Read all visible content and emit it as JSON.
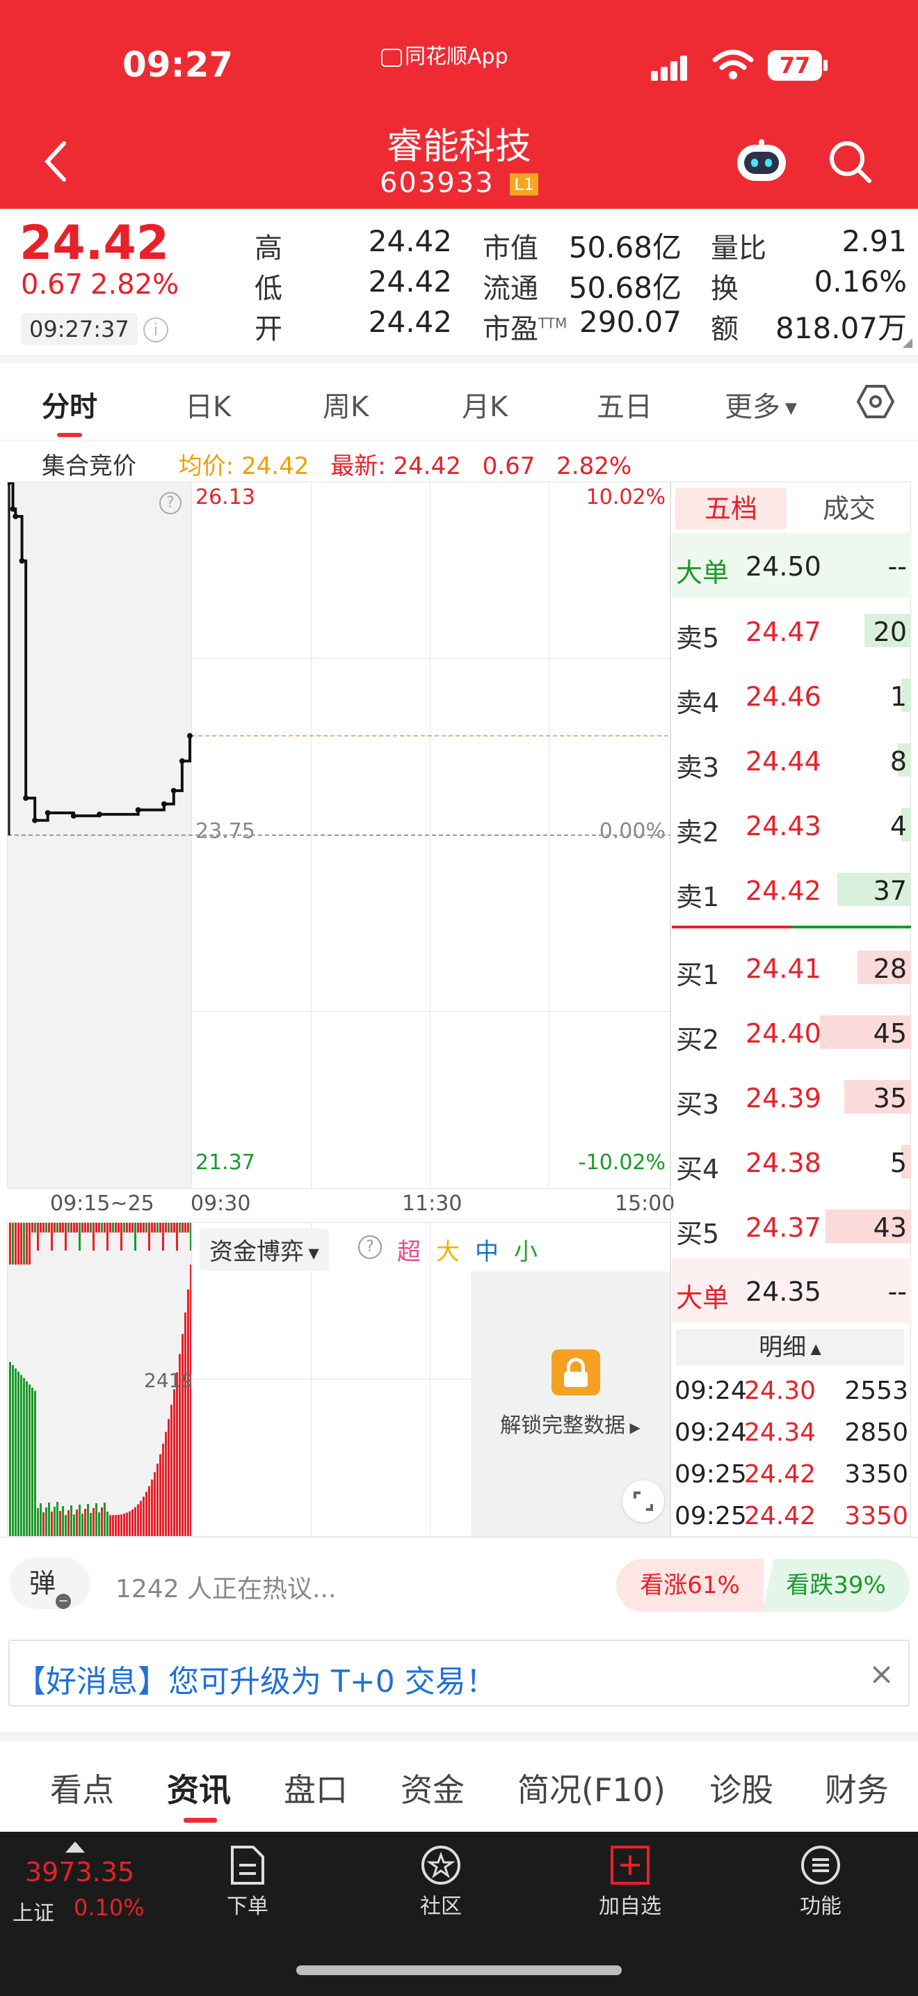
{
  "status_bar": {
    "time": "09:27",
    "app_label": "同花顺App",
    "battery": "77"
  },
  "header": {
    "title": "睿能科技",
    "code": "603933",
    "level_badge": "L1"
  },
  "quote": {
    "price": "24.42",
    "change": "0.67",
    "change_pct": "2.82%",
    "time": "09:27:37",
    "stats": [
      {
        "label": "高",
        "value": "24.42"
      },
      {
        "label": "低",
        "value": "24.42"
      },
      {
        "label": "开",
        "value": "24.42"
      },
      {
        "label": "市值",
        "value": "50.68亿"
      },
      {
        "label": "流通",
        "value": "50.68亿"
      },
      {
        "label": "市盈",
        "sup": "TTM",
        "value": "290.07"
      },
      {
        "label": "量比",
        "value": "2.91"
      },
      {
        "label": "换",
        "value": "0.16%"
      },
      {
        "label": "额",
        "value": "818.07万"
      }
    ]
  },
  "chart_tabs": [
    "分时",
    "日K",
    "周K",
    "月K",
    "五日",
    "更多"
  ],
  "auction_bar": {
    "label": "集合竞价",
    "avg": "均价: 24.42",
    "latest": "最新: 24.42",
    "change": "0.67",
    "change_pct": "2.82%"
  },
  "chart_data": {
    "type": "line",
    "title": "",
    "y_top": "26.13",
    "y_mid": "23.75",
    "y_bottom": "21.37",
    "pct_top": "10.02%",
    "pct_mid": "0.00%",
    "pct_bottom": "-10.02%",
    "ylim": [
      21.37,
      26.13
    ],
    "x_labels": [
      "09:15~25",
      "09:30",
      "11:30",
      "15:00"
    ],
    "auction_series": {
      "x": [
        0,
        6,
        10,
        20,
        26,
        40,
        60,
        100,
        140,
        200,
        240,
        255,
        268,
        280
      ],
      "y": [
        26.13,
        25.95,
        25.9,
        25.6,
        24.0,
        23.85,
        23.9,
        23.88,
        23.89,
        23.92,
        23.96,
        24.05,
        24.25,
        24.42
      ]
    },
    "ref_price": 23.75,
    "current_price": 24.42
  },
  "fund_panel": {
    "label": "资金博弈",
    "categories": [
      "超",
      "大",
      "中",
      "小"
    ],
    "side_value": "2419",
    "unlock": "解锁完整数据"
  },
  "order_book": {
    "tabs": [
      "五档",
      "成交"
    ],
    "big_sell": {
      "label": "大单",
      "price": "24.50",
      "vol": "--"
    },
    "asks": [
      {
        "label": "卖5",
        "price": "24.47",
        "vol": "20",
        "fill": 0.35
      },
      {
        "label": "卖4",
        "price": "24.46",
        "vol": "1",
        "fill": 0.02
      },
      {
        "label": "卖3",
        "price": "24.44",
        "vol": "8",
        "fill": 0.1
      },
      {
        "label": "卖2",
        "price": "24.43",
        "vol": "4",
        "fill": 0.05
      },
      {
        "label": "卖1",
        "price": "24.42",
        "vol": "37",
        "fill": 0.55
      }
    ],
    "bids": [
      {
        "label": "买1",
        "price": "24.41",
        "vol": "28",
        "fill": 0.4
      },
      {
        "label": "买2",
        "price": "24.40",
        "vol": "45",
        "fill": 0.68
      },
      {
        "label": "买3",
        "price": "24.39",
        "vol": "35",
        "fill": 0.5
      },
      {
        "label": "买4",
        "price": "24.38",
        "vol": "5",
        "fill": 0.06
      },
      {
        "label": "买5",
        "price": "24.37",
        "vol": "43",
        "fill": 0.64
      }
    ],
    "big_buy": {
      "label": "大单",
      "price": "24.35",
      "vol": "--"
    },
    "detail_label": "明细",
    "details": [
      {
        "time": "09:24",
        "price": "24.30",
        "vol": "2553",
        "vol_red": false
      },
      {
        "time": "09:24",
        "price": "24.34",
        "vol": "2850",
        "vol_red": false
      },
      {
        "time": "09:25",
        "price": "24.42",
        "vol": "3350",
        "vol_red": false
      },
      {
        "time": "09:25",
        "price": "24.42",
        "vol": "3350",
        "vol_red": true
      }
    ]
  },
  "discussion": {
    "danmu": "弹",
    "text": "1242 人正在热议...",
    "up": "看涨61%",
    "down": "看跌39%"
  },
  "notice": {
    "text": "【好消息】您可升级为 T+0 交易！"
  },
  "bottom_tabs": [
    "看点",
    "资讯",
    "盘口",
    "资金",
    "简况(F10)",
    "诊股",
    "财务"
  ],
  "nav": {
    "index_value": "3973.35",
    "index_name": "上证",
    "index_pct": "0.10%",
    "items": [
      "下单",
      "社区",
      "加自选",
      "功能"
    ]
  },
  "colors": {
    "header": "#ee2b33",
    "up": "#e8202a",
    "down": "#1a9a2a",
    "nav_bg": "#1b1b1b"
  }
}
